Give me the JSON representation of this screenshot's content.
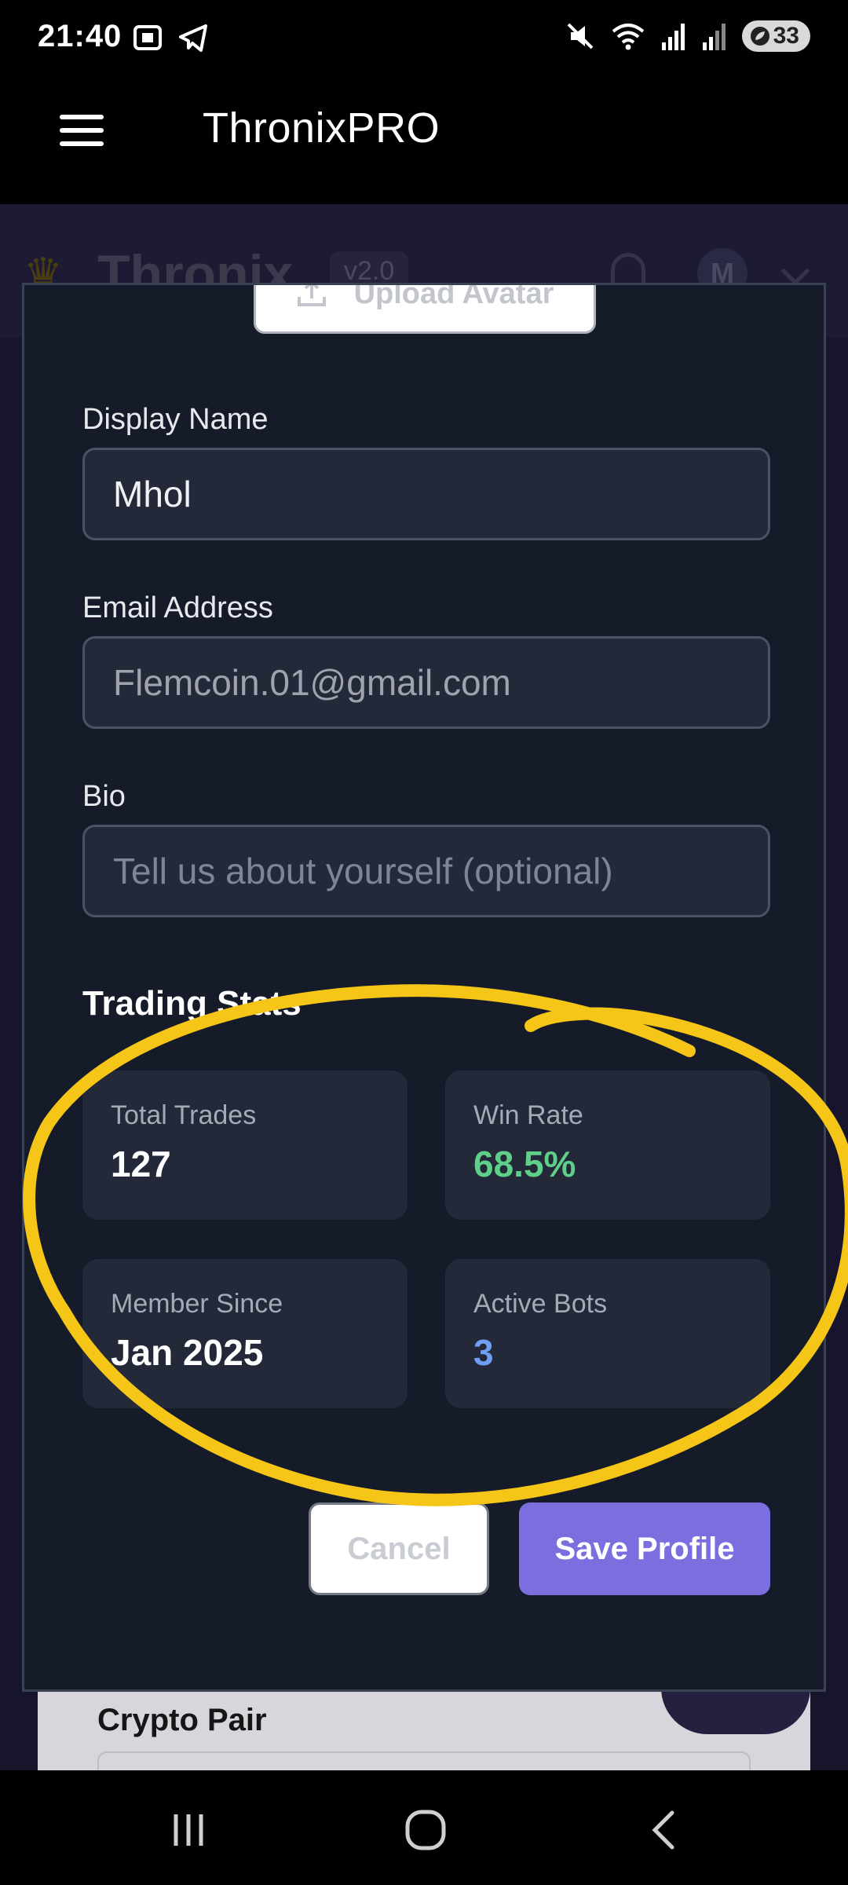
{
  "status_bar": {
    "time": "21:40",
    "battery": "33",
    "icons": [
      "screenshot-icon",
      "telegram-icon",
      "mute-icon",
      "wifi-icon",
      "signal-icon",
      "signal-icon",
      "battery-saver-icon"
    ]
  },
  "app_header": {
    "title": "ThronixPRO",
    "menu_icon": "hamburger-icon"
  },
  "underlay": {
    "brand": "Thronix",
    "version": "v2.0",
    "avatar_initial": "M",
    "card_label": "Crypto Pair"
  },
  "modal": {
    "upload_label": "Upload Avatar",
    "fields": {
      "display_name": {
        "label": "Display Name",
        "value": "Mhol"
      },
      "email": {
        "label": "Email Address",
        "value": "Flemcoin.01@gmail.com"
      },
      "bio": {
        "label": "Bio",
        "placeholder": "Tell us about yourself (optional)",
        "value": ""
      }
    },
    "stats_title": "Trading Stats",
    "stats": [
      {
        "label": "Total Trades",
        "value": "127",
        "color": "#ffffff"
      },
      {
        "label": "Win Rate",
        "value": "68.5%",
        "color": "#5fd08a"
      },
      {
        "label": "Member Since",
        "value": "Jan 2025",
        "color": "#ffffff"
      },
      {
        "label": "Active Bots",
        "value": "3",
        "color": "#6f9ff0"
      }
    ],
    "buttons": {
      "cancel": "Cancel",
      "save": "Save Profile"
    }
  },
  "colors": {
    "accent": "#7b6fe0",
    "annotation": "#f5c518",
    "modal_bg": "#151b28",
    "card_bg": "#232938"
  },
  "nav_bar": {
    "buttons": [
      "recents-icon",
      "home-icon",
      "back-icon"
    ]
  }
}
